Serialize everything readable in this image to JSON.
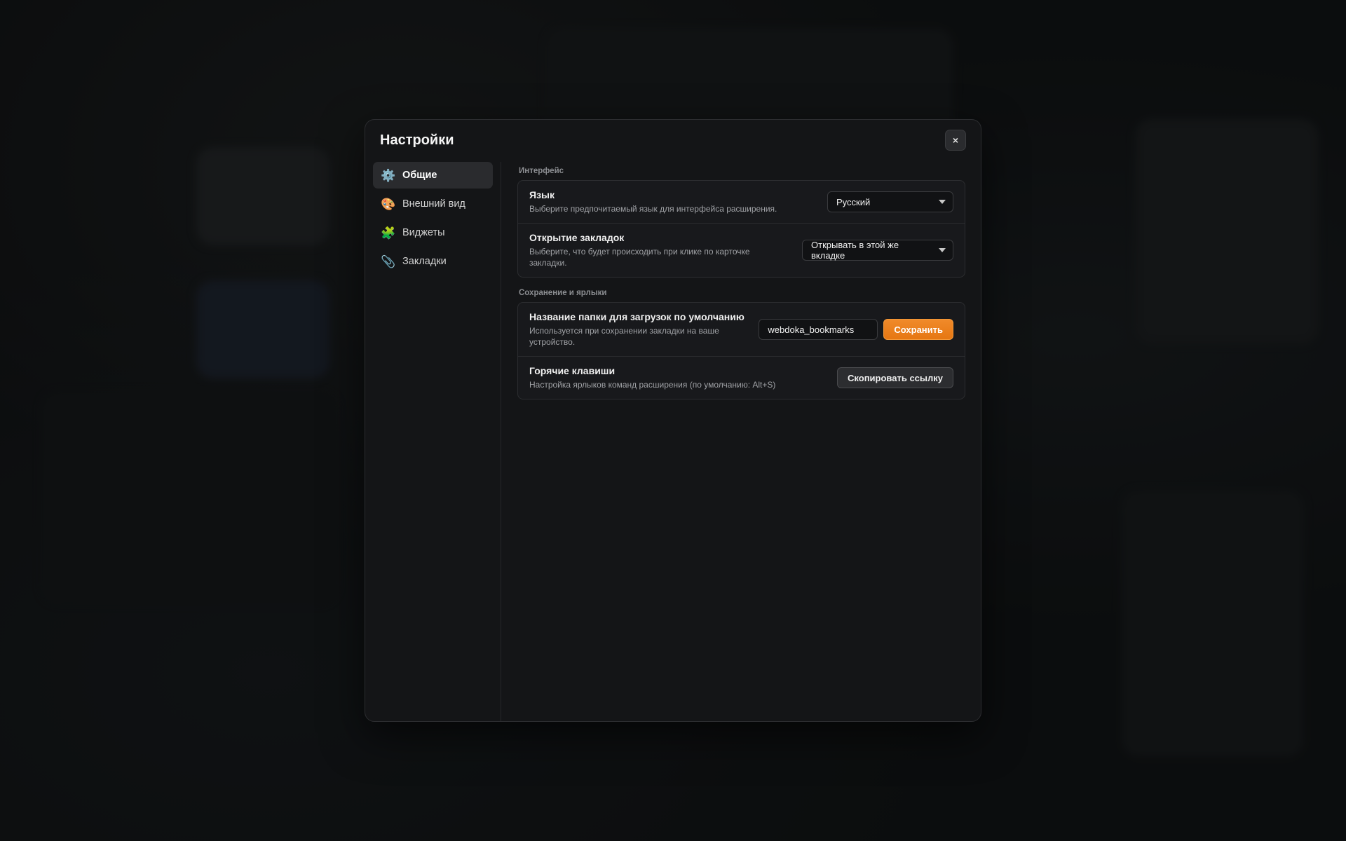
{
  "modal": {
    "title": "Настройки",
    "close_label": "×"
  },
  "sidebar": {
    "items": [
      {
        "label": "Общие",
        "icon": "gear-icon",
        "glyph": "⚙️"
      },
      {
        "label": "Внешний вид",
        "icon": "palette-icon",
        "glyph": "🎨"
      },
      {
        "label": "Виджеты",
        "icon": "puzzle-icon",
        "glyph": "🧩"
      },
      {
        "label": "Закладки",
        "icon": "paperclip-icon",
        "glyph": "📎"
      }
    ],
    "active": "Общие"
  },
  "sections": {
    "interface": {
      "label": "Интерфейс",
      "language": {
        "title": "Язык",
        "desc": "Выберите предпочитаемый язык для интерфейса расширения.",
        "value": "Русский"
      },
      "bookmark_open": {
        "title": "Открытие закладок",
        "desc": "Выберите, что будет происходить при клике по карточке закладки.",
        "value": "Открывать в этой же вкладке"
      }
    },
    "saving": {
      "label": "Сохранение и ярлыки",
      "folder": {
        "title": "Название папки для загрузок по умолчанию",
        "desc": "Используется при сохранении закладки на ваше устройство.",
        "value": "webdoka_bookmarks",
        "save_label": "Сохранить"
      },
      "hotkeys": {
        "title": "Горячие клавиши",
        "desc": "Настройка ярлыков команд расширения (по умолчанию: Alt+S)",
        "copy_label": "Скопировать ссылку"
      }
    }
  },
  "colors": {
    "accent": "#f08a2a",
    "background": "#111315",
    "modal": "#141517"
  }
}
